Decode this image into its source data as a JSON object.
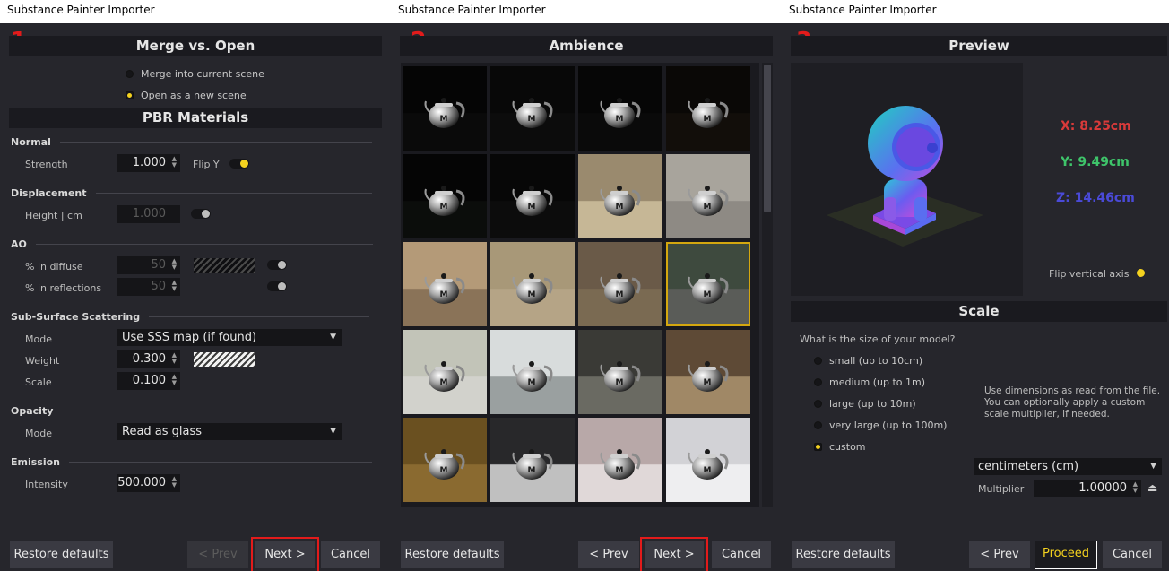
{
  "window_title": "Substance Painter Importer",
  "accent": "#f4d21f",
  "annotation_color": "#e21b1b",
  "panel1": {
    "step": "1",
    "merge_header": "Merge vs. Open",
    "merge_options": [
      "Merge into current scene",
      "Open as a new scene"
    ],
    "merge_selected": "Open as a new scene",
    "pbr_header": "PBR Materials",
    "normal": {
      "title": "Normal",
      "strength_label": "Strength",
      "strength_value": "1.000",
      "flip_label": "Flip Y"
    },
    "displacement": {
      "title": "Displacement",
      "height_label": "Height | cm",
      "height_value": "1.000"
    },
    "ao": {
      "title": "AO",
      "diffuse_label": "% in diffuse",
      "diffuse_value": "50",
      "reflections_label": "% in reflections",
      "reflections_value": "50"
    },
    "sss": {
      "title": "Sub-Surface Scattering",
      "mode_label": "Mode",
      "mode_value": "Use SSS map (if found)",
      "weight_label": "Weight",
      "weight_value": "0.300",
      "scale_label": "Scale",
      "scale_value": "0.100"
    },
    "opacity": {
      "title": "Opacity",
      "mode_label": "Mode",
      "mode_value": "Read as glass"
    },
    "emission": {
      "title": "Emission",
      "intensity_label": "Intensity",
      "intensity_value": "500.000"
    },
    "buttons": {
      "restore": "Restore defaults",
      "prev": "< Prev",
      "next": "Next >",
      "cancel": "Cancel"
    }
  },
  "panel2": {
    "step": "2",
    "header": "Ambience",
    "thumbnails": [
      {
        "bg": "#050505",
        "floor": "#0a0a0a"
      },
      {
        "bg": "#080808",
        "floor": "#0c0c0c"
      },
      {
        "bg": "#060606",
        "floor": "#0a0a0a"
      },
      {
        "bg": "#0a0806",
        "floor": "#120e0a"
      },
      {
        "bg": "#050505",
        "floor": "#0b0d0b"
      },
      {
        "bg": "#070707",
        "floor": "#0c0c0c"
      },
      {
        "bg": "#9a8a6e",
        "floor": "#c6b796"
      },
      {
        "bg": "#a8a49c",
        "floor": "#8e8a84"
      },
      {
        "bg": "#b49a78",
        "floor": "#8a7358"
      },
      {
        "bg": "#a89878",
        "floor": "#b5a486"
      },
      {
        "bg": "#6a5a48",
        "floor": "#7a6a52"
      },
      {
        "bg": "#3e4a3e",
        "floor": "#5a5c58"
      },
      {
        "bg": "#c2c4b8",
        "floor": "#d2d2cc"
      },
      {
        "bg": "#d8dcdc",
        "floor": "#9aa0a0"
      },
      {
        "bg": "#3a3a36",
        "floor": "#6a6a62"
      },
      {
        "bg": "#5e4a36",
        "floor": "#a08866"
      },
      {
        "bg": "#6a5020",
        "floor": "#8a6a30"
      },
      {
        "bg": "#28282a",
        "floor": "#c0c0c0"
      },
      {
        "bg": "#b8a8a8",
        "floor": "#e0d8d8"
      },
      {
        "bg": "#d2d2d6",
        "floor": "#eeeef0"
      }
    ],
    "selected_index": 11,
    "buttons": {
      "restore": "Restore defaults",
      "prev": "< Prev",
      "next": "Next >",
      "cancel": "Cancel"
    }
  },
  "panel3": {
    "step": "3",
    "preview_header": "Preview",
    "dims": {
      "x": "X: 8.25cm",
      "y": "Y: 9.49cm",
      "z": "Z: 14.46cm",
      "x_color": "#d93a3a",
      "y_color": "#3ec46a",
      "z_color": "#4a4ad8"
    },
    "flip_label": "Flip vertical axis",
    "scale_header": "Scale",
    "question": "What is the size of your model?",
    "sizes": [
      "small (up to 10cm)",
      "medium (up to 1m)",
      "large (up to 10m)",
      "very large (up to 100m)",
      "custom"
    ],
    "size_selected": "custom",
    "info": "Use dimensions as read from the file. You can optionally apply a custom scale multiplier, if needed.",
    "unit_value": "centimeters (cm)",
    "multiplier_label": "Multiplier",
    "multiplier_value": "1.00000",
    "buttons": {
      "restore": "Restore defaults",
      "prev": "< Prev",
      "proceed": "Proceed",
      "cancel": "Cancel"
    }
  }
}
